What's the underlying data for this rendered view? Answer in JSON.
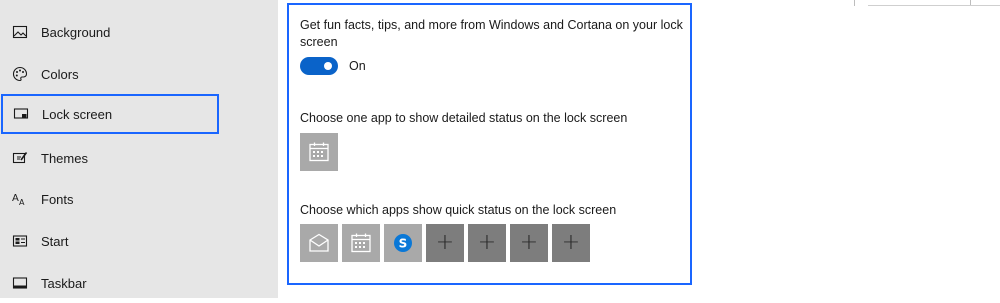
{
  "sidebar": {
    "items": [
      {
        "label": "Background",
        "icon": "picture-icon"
      },
      {
        "label": "Colors",
        "icon": "palette-icon"
      },
      {
        "label": "Lock screen",
        "icon": "lock-screen-icon"
      },
      {
        "label": "Themes",
        "icon": "themes-icon"
      },
      {
        "label": "Fonts",
        "icon": "fonts-icon"
      },
      {
        "label": "Start",
        "icon": "start-icon"
      },
      {
        "label": "Taskbar",
        "icon": "taskbar-icon"
      }
    ],
    "selected": "Lock screen"
  },
  "main": {
    "fun_facts_text": "Get fun facts, tips, and more from Windows and Cortana on your lock screen",
    "fun_facts_line1": "Get fun facts, tips, and more from Windows and Cortana on your lock",
    "fun_facts_line2": "screen",
    "toggle_state": "On",
    "detailed_status_heading": "Choose one app to show detailed status on the lock screen",
    "detailed_status_app": "calendar-icon",
    "quick_status_heading": "Choose which apps show quick status on the lock screen",
    "quick_status_apps": [
      "mail-icon",
      "calendar-icon",
      "skype-icon",
      "add-icon",
      "add-icon",
      "add-icon",
      "add-icon"
    ]
  },
  "colors": {
    "accent": "#0a63c9",
    "highlight_border": "#1a66ff",
    "sidebar_bg": "#e6e6e6",
    "tile_bg": "#7d7d7d"
  }
}
